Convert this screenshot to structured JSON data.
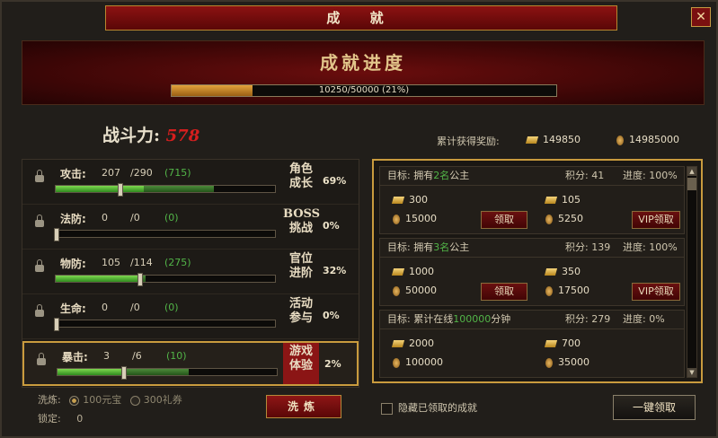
{
  "window": {
    "title": "成 就",
    "close_label": "✕"
  },
  "banner": {
    "title": "成就进度",
    "progress_text": "10250/50000 (21%)",
    "progress_fraction": 0.21
  },
  "power": {
    "label": "战斗力:",
    "value": "578"
  },
  "rewards": {
    "label": "累计获得奖励:",
    "gold": "149850",
    "coin": "14985000"
  },
  "stats": [
    {
      "name": "攻击:",
      "cur": "207",
      "max": "/290",
      "extra": "(715)",
      "fill": 0.4,
      "fill2": 0.72,
      "knob": 0.29
    },
    {
      "name": "法防:",
      "cur": "0",
      "max": "/0",
      "extra": "(0)",
      "fill": 0,
      "fill2": 0,
      "knob": 0
    },
    {
      "name": "物防:",
      "cur": "105",
      "max": "/114",
      "extra": "(275)",
      "fill": 0.38,
      "fill2": 0.41,
      "knob": 0.38
    },
    {
      "name": "生命:",
      "cur": "0",
      "max": "/0",
      "extra": "(0)",
      "fill": 0,
      "fill2": 0,
      "knob": 0
    },
    {
      "name": "暴击:",
      "cur": "3",
      "max": "/6",
      "extra": "(10)",
      "fill": 0.3,
      "fill2": 0.6,
      "knob": 0.3
    }
  ],
  "categories": [
    {
      "line1": "角色",
      "line2": "成长",
      "pct": "69%"
    },
    {
      "line1": "BOSS",
      "line2": "挑战",
      "pct": "0%"
    },
    {
      "line1": "官位",
      "line2": "进阶",
      "pct": "32%"
    },
    {
      "line1": "活动",
      "line2": "参与",
      "pct": "0%"
    },
    {
      "line1": "游戏",
      "line2": "体验",
      "pct": "2%"
    }
  ],
  "wash": {
    "label": "洗炼:",
    "opt1": "100元宝",
    "opt2": "300礼券",
    "lock_label": "锁定:",
    "lock_value": "0",
    "button": "洗炼"
  },
  "achievements": [
    {
      "goal_pre": "目标: 拥有",
      "goal_hl": "2名",
      "goal_post": "公主",
      "points": "积分: 41",
      "progress": "进度: 100%",
      "gold": "300",
      "coin": "15000",
      "vip_gold": "105",
      "vip_coin": "5250",
      "claim": "领取",
      "vip_claim": "VIP领取"
    },
    {
      "goal_pre": "目标: 拥有",
      "goal_hl": "3名",
      "goal_post": "公主",
      "points": "积分: 139",
      "progress": "进度: 100%",
      "gold": "1000",
      "coin": "50000",
      "vip_gold": "350",
      "vip_coin": "17500",
      "claim": "领取",
      "vip_claim": "VIP领取"
    },
    {
      "goal_pre": "目标: 累计在线",
      "goal_hl": "100000",
      "goal_post": "分钟",
      "points": "积分: 279",
      "progress": "进度: 0%",
      "gold": "2000",
      "coin": "100000",
      "vip_gold": "700",
      "vip_coin": "35000"
    }
  ],
  "footer": {
    "hide_label": "隐藏已领取的成就",
    "onekey": "一键领取"
  }
}
